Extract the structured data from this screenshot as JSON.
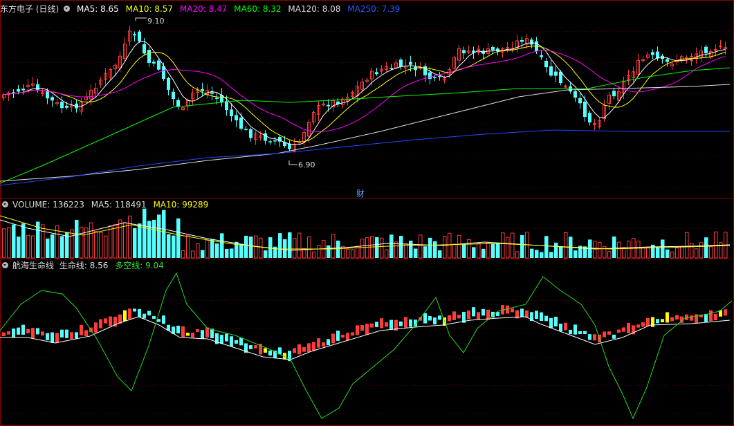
{
  "colors": {
    "background": "#000000",
    "frame": "#8b0000",
    "up": "#ff3c3c",
    "down": "#54ffff",
    "ma5": "#ffffff",
    "ma10": "#ffff00",
    "ma20": "#ff00ff",
    "ma60": "#00ff00",
    "ma120": "#e0e0e0",
    "ma250": "#1e4bff",
    "lifeline_neutral": "#ffff00",
    "duokong": "#22dd22"
  },
  "price_pane": {
    "title": "东方电子 (日线)",
    "ma5": "MA5: 8.65",
    "ma10": "MA10: 8.57",
    "ma20": "MA20: 8.47",
    "ma60": "MA60: 8.32",
    "ma120": "MA120: 8.08",
    "ma250": "MA250: 7.39",
    "high_label": "9.10",
    "low_label": "6.90",
    "finance_marker": "财"
  },
  "volume_pane": {
    "volume": "VOLUME: 136223",
    "ma5": "MA5: 118491",
    "ma10": "MA10: 99289"
  },
  "indicator_pane": {
    "name": "航海生命线",
    "lifeline": "生命线: 8.56",
    "duokong": "多空线: 9.04"
  }
}
